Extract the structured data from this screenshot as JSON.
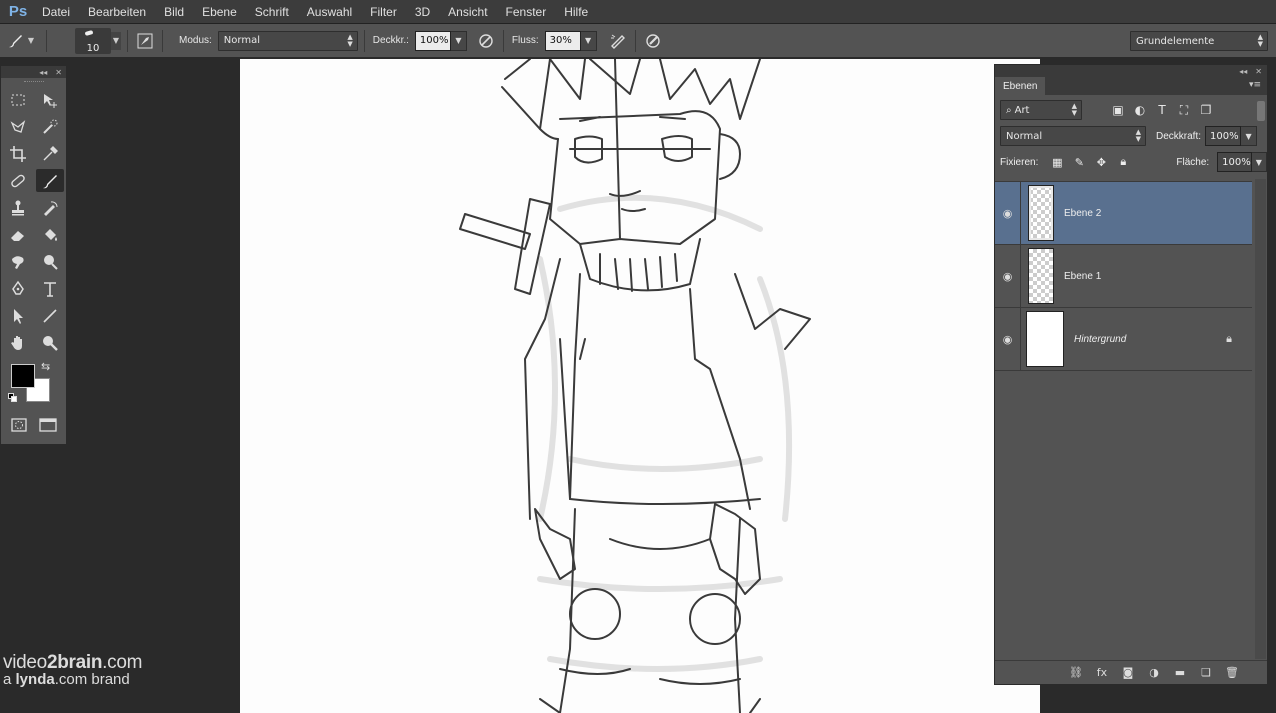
{
  "app": {
    "logo": "Ps"
  },
  "menu": [
    "Datei",
    "Bearbeiten",
    "Bild",
    "Ebene",
    "Schrift",
    "Auswahl",
    "Filter",
    "3D",
    "Ansicht",
    "Fenster",
    "Hilfe"
  ],
  "options": {
    "brush_size": "10",
    "mode_label": "Modus:",
    "mode_value": "Normal",
    "opacity_label": "Deckkr.:",
    "opacity_value": "100%",
    "flow_label": "Fluss:",
    "flow_value": "30%",
    "workspace": "Grundelemente"
  },
  "colors": {
    "foreground": "#000000",
    "background": "#ffffff",
    "selected_layer": "#59708f"
  },
  "watermark": {
    "brand_light": "video",
    "brand_bold": "2brain",
    "brand_tld": ".com",
    "sub_a": "a ",
    "sub_b": "lynda",
    "sub_c": ".com brand"
  },
  "layers_panel": {
    "tab": "Ebenen",
    "filter_kind": "Art",
    "blend_mode": "Normal",
    "opacity_label": "Deckkraft:",
    "opacity_value": "100%",
    "lock_label": "Fixieren:",
    "fill_label": "Fläche:",
    "fill_value": "100%",
    "layers": [
      {
        "name": "Ebene 2",
        "selected": true
      },
      {
        "name": "Ebene 1",
        "selected": false
      },
      {
        "name": "Hintergrund",
        "selected": false,
        "locked": true
      }
    ]
  }
}
